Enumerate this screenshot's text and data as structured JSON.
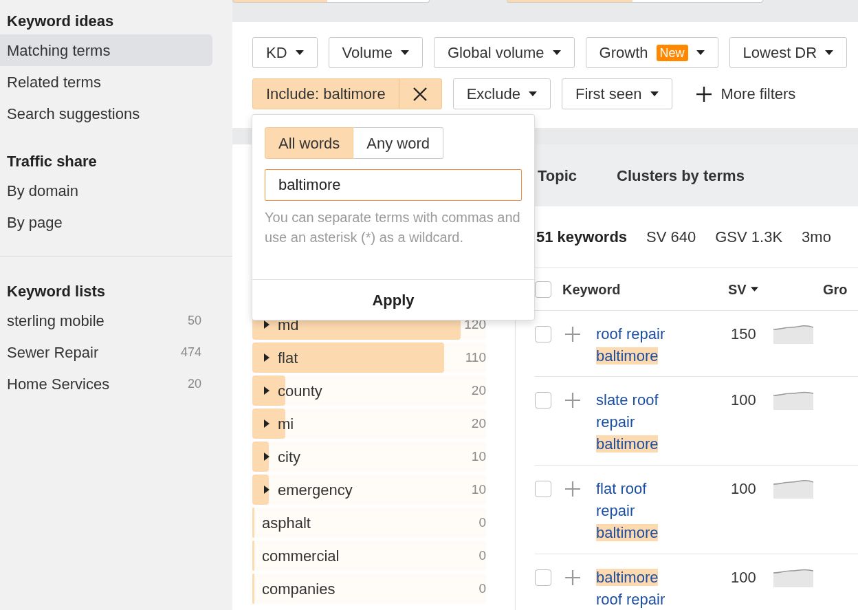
{
  "sidebar": {
    "sections": [
      {
        "title": "Keyword ideas",
        "items": [
          {
            "label": "Matching terms",
            "selected": true
          },
          {
            "label": "Related terms",
            "selected": false
          },
          {
            "label": "Search suggestions",
            "selected": false
          }
        ]
      },
      {
        "title": "Traffic share",
        "items": [
          {
            "label": "By domain",
            "selected": false
          },
          {
            "label": "By page",
            "selected": false
          }
        ]
      },
      {
        "title": "Keyword lists",
        "items": [
          {
            "label": "sterling mobile",
            "count": "50",
            "selected": false
          },
          {
            "label": "Sewer Repair",
            "count": "474",
            "selected": false
          },
          {
            "label": "Home Services",
            "count": "20",
            "selected": false
          }
        ]
      }
    ]
  },
  "filters": [
    [
      {
        "kind": "dropdown",
        "label": "KD"
      },
      {
        "kind": "dropdown",
        "label": "Volume"
      },
      {
        "kind": "dropdown",
        "label": "Global volume"
      },
      {
        "kind": "dropdown",
        "label": "Growth",
        "badge": "New"
      },
      {
        "kind": "dropdown",
        "label": "Lowest DR"
      }
    ],
    [
      {
        "kind": "active",
        "label": "Include: baltimore"
      },
      {
        "kind": "dropdown",
        "label": "Exclude"
      },
      {
        "kind": "dropdown",
        "label": "First seen"
      },
      {
        "kind": "add",
        "label": "More filters"
      }
    ]
  ],
  "include_popup": {
    "modes": [
      {
        "label": "All words",
        "selected": true
      },
      {
        "label": "Any word",
        "selected": false
      }
    ],
    "value": "baltimore",
    "hint": "You can separate terms with commas and use an asterisk (*) as a wildcard.",
    "apply": "Apply"
  },
  "tabs": [
    {
      "label": "Topic",
      "selected": false
    },
    {
      "label": "Clusters by terms",
      "selected": false
    }
  ],
  "stats": {
    "keywords": "51 keywords",
    "items": [
      "SV 640",
      "GSV 1.3K",
      "3mo"
    ]
  },
  "terms": [
    {
      "label": "md",
      "count": "120",
      "level": 0.89,
      "expandable": true
    },
    {
      "label": "flat",
      "count": "110",
      "level": 0.82,
      "expandable": true
    },
    {
      "label": "county",
      "count": "20",
      "level": 0.14,
      "expandable": true
    },
    {
      "label": "mi",
      "count": "20",
      "level": 0.14,
      "expandable": true
    },
    {
      "label": "city",
      "count": "10",
      "level": 0.07,
      "expandable": true
    },
    {
      "label": "emergency",
      "count": "10",
      "level": 0.07,
      "expandable": true
    },
    {
      "label": "asphalt",
      "count": "0",
      "level": 0.01,
      "expandable": false
    },
    {
      "label": "commercial",
      "count": "0",
      "level": 0.01,
      "expandable": false
    },
    {
      "label": "companies",
      "count": "0",
      "level": 0.01,
      "expandable": false
    }
  ],
  "table": {
    "all_checked": false,
    "columns": [
      {
        "label": "Keyword",
        "sorted": false
      },
      {
        "label": "SV",
        "sorted": true
      },
      {
        "label": "Gro",
        "sorted": false
      }
    ],
    "rows": [
      {
        "keyword": [
          {
            "text": "roof repair",
            "highlight": false
          },
          {
            "text": "baltimore",
            "highlight": true
          }
        ],
        "sv": "150",
        "checked": false
      },
      {
        "keyword": [
          {
            "text": "slate roof repair",
            "highlight": false
          },
          {
            "text": "baltimore",
            "highlight": true
          }
        ],
        "sv": "100",
        "checked": false
      },
      {
        "keyword": [
          {
            "text": "flat roof repair",
            "highlight": false
          },
          {
            "text": "baltimore",
            "highlight": true
          }
        ],
        "sv": "100",
        "checked": false
      },
      {
        "keyword": [
          {
            "text": "baltimore",
            "highlight": true
          },
          {
            "text": "roof repair",
            "highlight": false
          }
        ],
        "sv": "100",
        "checked": false
      }
    ]
  }
}
